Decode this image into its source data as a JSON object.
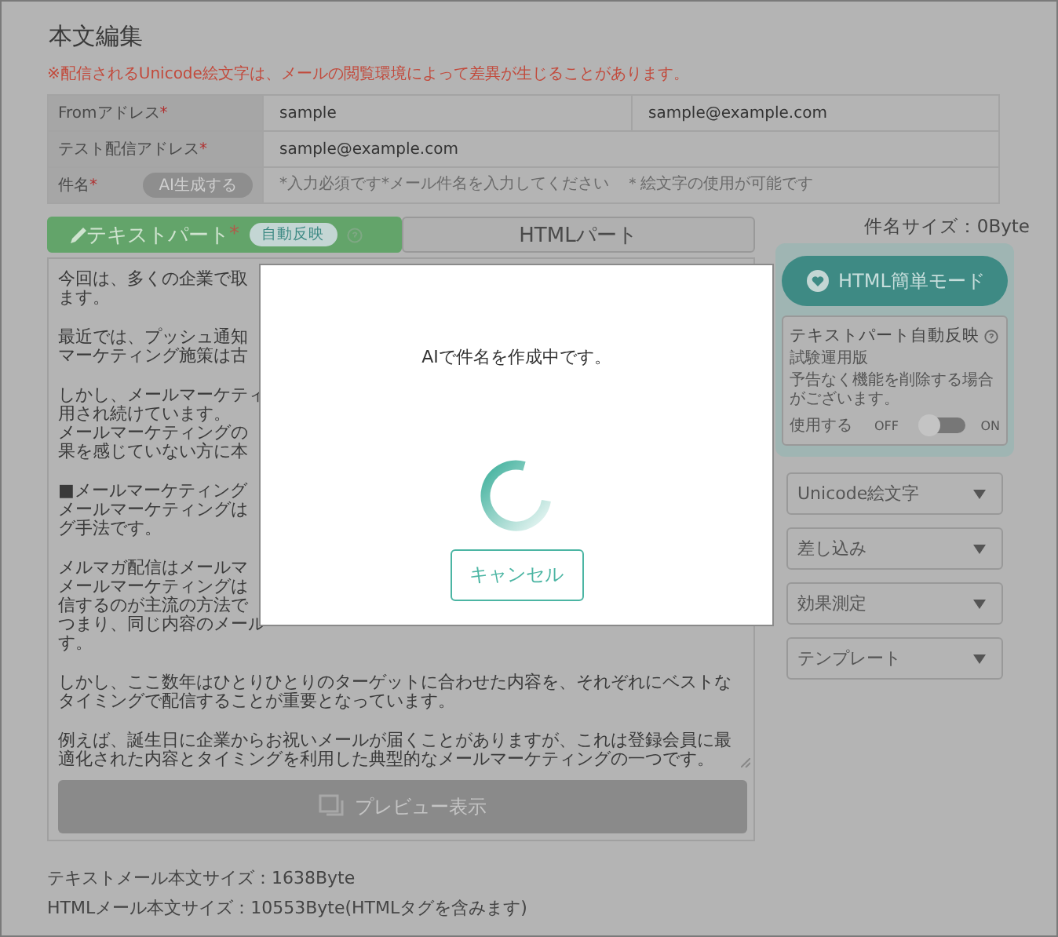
{
  "page_title": "本文編集",
  "required_mark": "*",
  "notice": "※配信されるUnicode絵文字は、メールの閲覧環境によって差異が生じることがあります。",
  "fields": [
    {
      "label": "Fromアドレス",
      "required": true,
      "values": [
        "sample",
        "sample@example.com"
      ]
    },
    {
      "label": "テスト配信アドレス",
      "required": true,
      "values": [
        "sample@example.com"
      ]
    },
    {
      "label": "件名",
      "required": true,
      "button": "AI生成する",
      "placeholder": "*入力必須です*メール件名を入力してください　＊絵文字の使用が可能です"
    }
  ],
  "subject_size": "件名サイズ：0Byte",
  "tabs": [
    {
      "label": "テキストパート",
      "required": true,
      "badge": "自動反映",
      "selected": true
    },
    {
      "label": "HTMLパート",
      "required": false,
      "selected": false
    }
  ],
  "body_paragraphs": [
    [
      "今回は、多くの企業で取",
      "ます。"
    ],
    [
      "最近では、プッシュ通知",
      "マーケティング施策は古"
    ],
    [
      "しかし、メールマーケティ",
      "用され続けています。",
      "メールマーケティングの",
      "果を感じていない方に本"
    ],
    [
      "■メールマーケティング",
      "メールマーケティングは",
      "グ手法です。"
    ],
    [
      "メルマガ配信はメールマ",
      "メールマーケティングは",
      "信するのが主流の方法で",
      "つまり、同じ内容のメール",
      "す。"
    ],
    [
      "しかし、ここ数年はひとりひとりのターゲットに合わせた内容を、それぞれにベストな",
      "タイミングで配信することが重要となっています。"
    ],
    [
      "例えば、誕生日に企業からお祝いメールが届くことがありますが、これは登録会員に最",
      "適化された内容とタイミングを利用した典型的なメールマーケティングの一つです。"
    ]
  ],
  "preview_button": "プレビュー表示",
  "sizes": [
    "テキストメール本文サイズ：1638Byte",
    "HTMLメール本文サイズ：10553Byte(HTMLタグを含みます)"
  ],
  "sidebar": {
    "mode_button": "HTML簡単モード",
    "auto_reflect": {
      "title": "テキストパート自動反映",
      "notes": [
        "試験運用版",
        "予告なく機能を削除する場合がございます。"
      ],
      "label": "使用する",
      "off_label": "OFF",
      "on_label": "ON",
      "enabled": false
    },
    "menus": [
      "Unicode絵文字",
      "差し込み",
      "効果測定",
      "テンプレート"
    ]
  },
  "modal": {
    "message": "AIで件名を作成中です。",
    "cancel": "キャンセル"
  }
}
